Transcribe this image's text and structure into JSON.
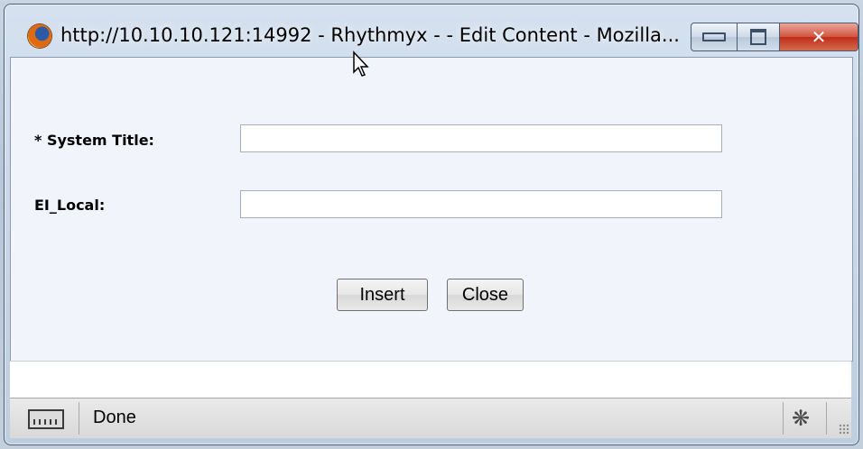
{
  "window": {
    "title": "http://10.10.10.121:14992 - Rhythmyx - - Edit Content - Mozilla..."
  },
  "form": {
    "fields": [
      {
        "label": "* System Title:",
        "value": ""
      },
      {
        "label": "EI_Local:",
        "value": ""
      }
    ],
    "buttons": {
      "insert": "Insert",
      "close": "Close"
    }
  },
  "statusbar": {
    "text": "Done"
  },
  "icons": {
    "app": "firefox-icon",
    "minimize": "minimize-icon",
    "maximize": "maximize-icon",
    "close": "close-icon",
    "status": "status-display-icon",
    "bug": "bug-icon",
    "cursor": "mouse-pointer-icon"
  },
  "colors": {
    "close_button": "#c4341c",
    "content_bg": "#f1f5fb"
  }
}
